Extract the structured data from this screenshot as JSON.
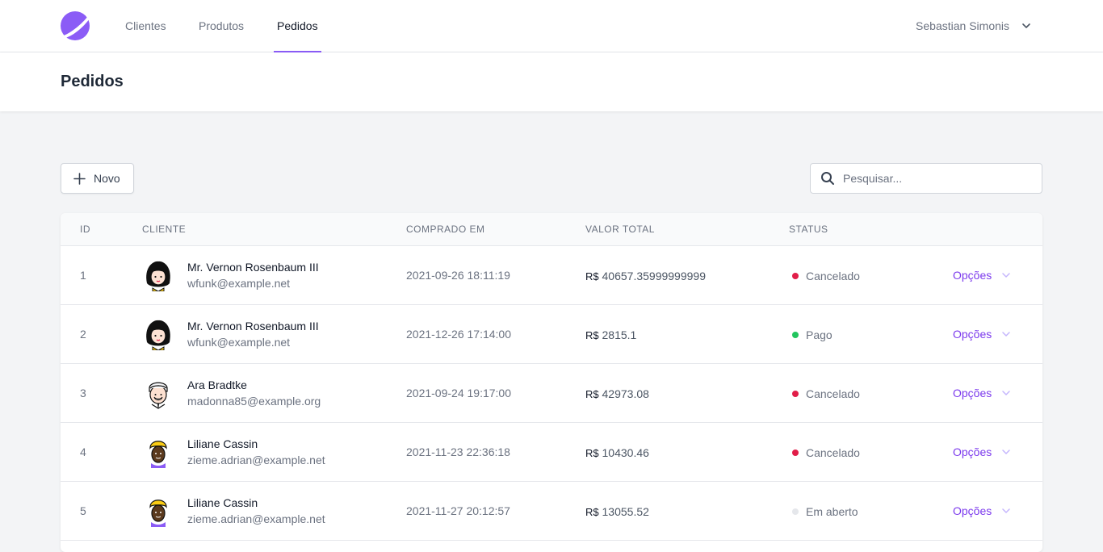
{
  "nav": {
    "items": [
      {
        "label": "Clientes",
        "active": false
      },
      {
        "label": "Produtos",
        "active": false
      },
      {
        "label": "Pedidos",
        "active": true
      }
    ],
    "user_name": "Sebastian Simonis"
  },
  "colors": {
    "accent": "#8b5cf6",
    "link": "#7c3aed",
    "status_canceled": "#e11d48",
    "status_paid": "#22c55e",
    "status_open": "#e5e7eb"
  },
  "header": {
    "title": "Pedidos"
  },
  "toolbar": {
    "new_label": "Novo",
    "search_placeholder": "Pesquisar..."
  },
  "table": {
    "columns": [
      "ID",
      "CLIENTE",
      "COMPRADO EM",
      "VALOR TOTAL",
      "STATUS"
    ],
    "currency": "R$",
    "options_label": "Opções",
    "rows": [
      {
        "id": "1",
        "name": "Mr. Vernon Rosenbaum III",
        "email": "wfunk@example.net",
        "date": "2021-09-26 18:11:19",
        "total": "40657.35999999999",
        "status": "Cancelado",
        "status_color": "#e11d48",
        "avatar": "avatar-woman-black-hair"
      },
      {
        "id": "2",
        "name": "Mr. Vernon Rosenbaum III",
        "email": "wfunk@example.net",
        "date": "2021-12-26 17:14:00",
        "total": "2815.1",
        "status": "Pago",
        "status_color": "#22c55e",
        "avatar": "avatar-woman-black-hair"
      },
      {
        "id": "3",
        "name": "Ara Bradtke",
        "email": "madonna85@example.org",
        "date": "2021-09-24 19:17:00",
        "total": "42973.08",
        "status": "Cancelado",
        "status_color": "#e11d48",
        "avatar": "avatar-old-man"
      },
      {
        "id": "4",
        "name": "Liliane Cassin",
        "email": "zieme.adrian@example.net",
        "date": "2021-11-23 22:36:18",
        "total": "10430.46",
        "status": "Cancelado",
        "status_color": "#e11d48",
        "avatar": "avatar-woman-yellow-turban"
      },
      {
        "id": "5",
        "name": "Liliane Cassin",
        "email": "zieme.adrian@example.net",
        "date": "2021-11-27 20:12:57",
        "total": "13055.52",
        "status": "Em aberto",
        "status_color": "#e5e7eb",
        "avatar": "avatar-woman-yellow-turban"
      }
    ]
  }
}
